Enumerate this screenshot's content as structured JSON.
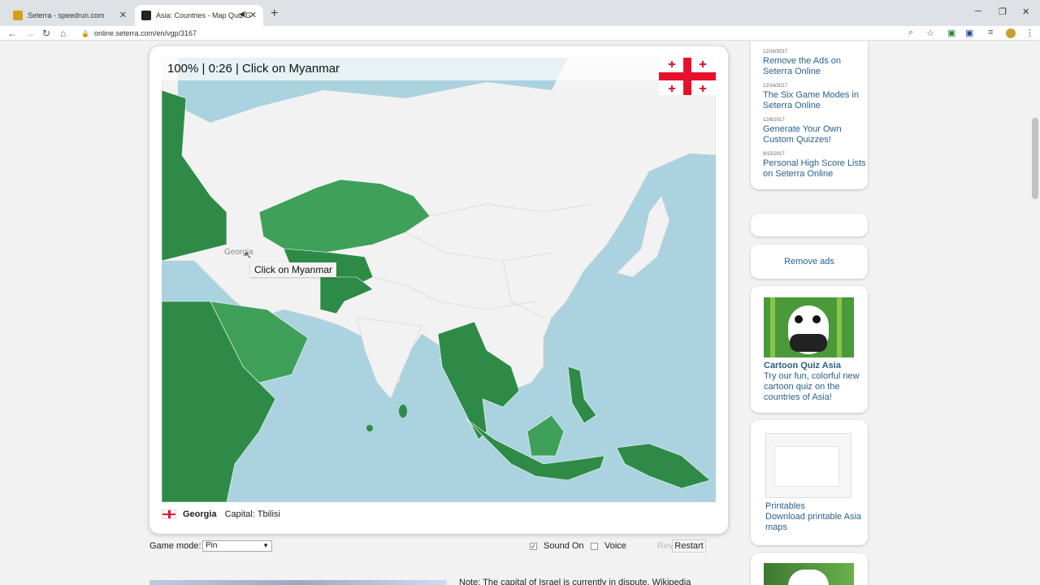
{
  "browser": {
    "tabs": [
      {
        "title": "Seterra - speedrun.com"
      },
      {
        "title": "Asia: Countries - Map Quiz G"
      }
    ],
    "url": "online.seterra.com/en/vgp/3167"
  },
  "game": {
    "status": "100% | 0:26 | Click on Myanmar",
    "tooltip": "Click on Myanmar",
    "hover_label": "Georgia",
    "flag_country": "Georgia",
    "info_country": "Georgia",
    "info_capital": "Capital: Tbilisi",
    "colors": {
      "water": "#aad3df",
      "land": "#f2f2f2",
      "correct": "#2e8b47",
      "correct_light": "#3fa05a"
    }
  },
  "controls": {
    "mode_label": "Game mode:",
    "mode_value": "Pin",
    "sound": "Sound On",
    "sound_checked": true,
    "voice": "Voice",
    "voice_checked": false,
    "review": "Review",
    "restart": "Restart"
  },
  "note": "Note: The capital of Israel is currently in dispute. Wikipedia",
  "sidebar": {
    "news": [
      {
        "date": "12/18/2017",
        "title": "Remove the Ads on Seterra Online"
      },
      {
        "date": "12/14/2017",
        "title": "The Six Game Modes in Seterra Online"
      },
      {
        "date": "12/6/2017",
        "title": "Generate Your Own Custom Quizzes!"
      },
      {
        "date": "9/15/2017",
        "title": "Personal High Score Lists on Seterra Online"
      }
    ],
    "remove_ads": "Remove ads",
    "cartoon_title": "Cartoon Quiz Asia",
    "cartoon_text": "Try our fun, colorful new cartoon quiz on the countries of Asia!",
    "printables_title": "Printables",
    "printables_text": "Download printable Asia maps"
  }
}
